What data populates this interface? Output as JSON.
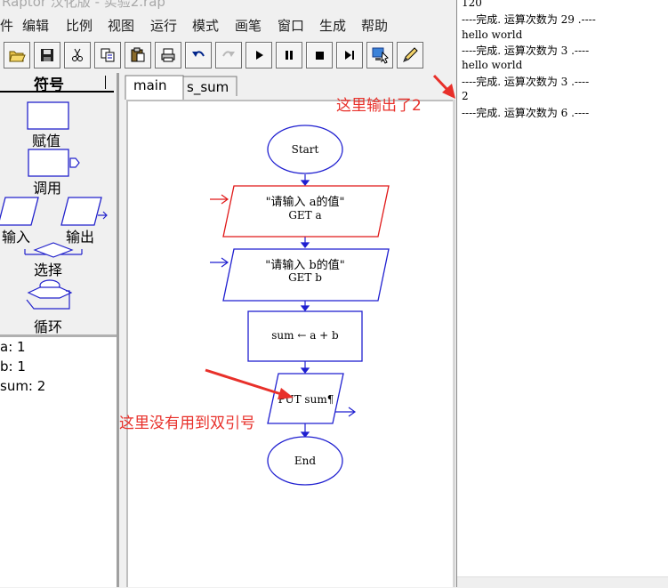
{
  "window": {
    "title": "Raptor 汉化版 - 实验2.rap"
  },
  "menu": [
    "件",
    "编辑",
    "比例",
    "视图",
    "运行",
    "模式",
    "画笔",
    "窗口",
    "生成",
    "帮助"
  ],
  "toolbar": {
    "buttons": [
      "open-folder",
      "save",
      "cut",
      "copy",
      "paste",
      "print",
      "undo",
      "redo",
      "play",
      "pause",
      "stop",
      "step",
      "monitor",
      "pen"
    ]
  },
  "symbols": {
    "header": "符号",
    "items": [
      "赋值",
      "调用",
      "输入",
      "输出",
      "选择",
      "循环"
    ]
  },
  "variables": [
    "a: 1",
    "b: 1",
    "sum: 2"
  ],
  "tabs": [
    "main",
    "s_sum"
  ],
  "flowchart": {
    "start": "Start",
    "input1_prompt": "\"请输入 a的值\"",
    "input1_get": "GET a",
    "input2_prompt": "\"请输入 b的值\"",
    "input2_get": "GET b",
    "assign": "sum ← a + b",
    "output": "PUT sum¶",
    "end": "End"
  },
  "console": {
    "lines": [
      "120",
      "----完成. 运算次数为  29 .----",
      "hello world",
      "----完成. 运算次数为  3 .----",
      "hello world",
      "----完成. 运算次数为  3 .----",
      "2",
      "----完成. 运算次数为  6 .----"
    ]
  },
  "annotations": {
    "output_note": "这里输出了2",
    "quote_note": "这里没有用到双引号"
  },
  "colors": {
    "flow_blue": "#1f1fd0",
    "flow_red": "#e01818",
    "annotation_red": "#e8302a"
  }
}
